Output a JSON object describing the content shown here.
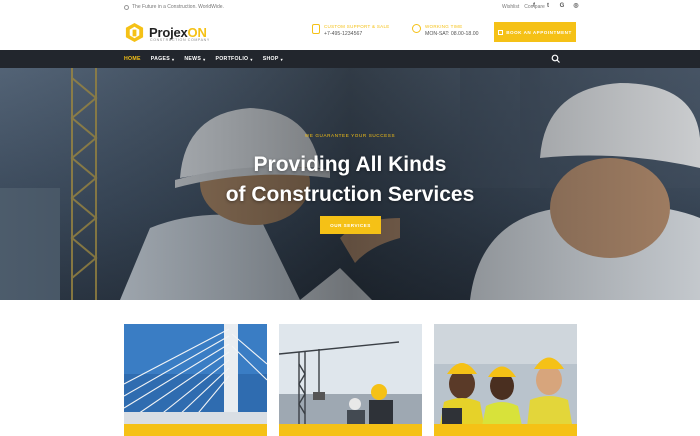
{
  "topbar": {
    "tagline": "The Future in a Construction. WorldWide.",
    "links": [
      "Wishlist",
      "Compare"
    ],
    "socials": [
      "facebook-icon",
      "twitter-icon",
      "google-icon",
      "instagram-icon"
    ]
  },
  "header": {
    "logo_main": "Projex",
    "logo_accent": "ON",
    "logo_sub": "CONSTRUCTION COMPANY",
    "support_label": "CUSTOM SUPPORT & SALE",
    "support_value": "+7-495-1234567",
    "hours_label": "WORKING TIME",
    "hours_value": "MON-SAT: 08.00-18.00",
    "cta_label": "BOOK AN APPOINTMENT"
  },
  "nav": {
    "items": [
      {
        "label": "HOME",
        "has_menu": false
      },
      {
        "label": "PAGES",
        "has_menu": true
      },
      {
        "label": "NEWS",
        "has_menu": true
      },
      {
        "label": "PORTFOLIO",
        "has_menu": true
      },
      {
        "label": "SHOP",
        "has_menu": true
      }
    ]
  },
  "hero": {
    "kicker": "WE GUARANTEE YOUR SUCCESS",
    "title_line1": "Providing All Kinds",
    "title_line2": "of Construction Services",
    "button_label": "OUR SERVICES"
  },
  "colors": {
    "accent": "#f5c116",
    "nav_bg": "#22262d"
  }
}
